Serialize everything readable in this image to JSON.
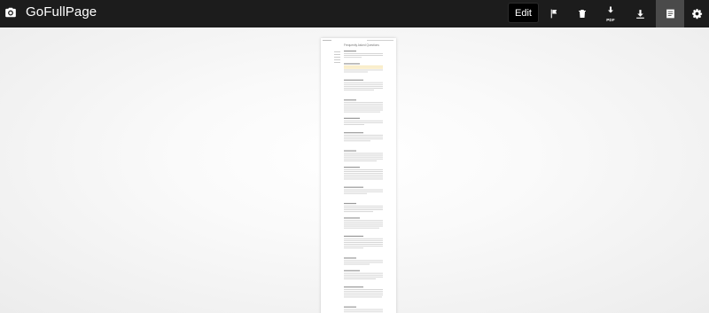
{
  "app": {
    "title": "GoFullPage",
    "icon": "camera-icon"
  },
  "toolbar": {
    "edit_label": "Edit",
    "pdf_badge": "PDF",
    "tools": [
      {
        "name": "flag-icon"
      },
      {
        "name": "trash-icon"
      },
      {
        "name": "download-pdf-icon"
      },
      {
        "name": "download-icon"
      },
      {
        "name": "document-icon",
        "active": true
      },
      {
        "name": "gear-icon"
      }
    ]
  },
  "preview": {
    "page_heading": "Frequently Asked Questions"
  },
  "colors": {
    "topbar": "#1c1c1c",
    "active_tool": "#4a4a4a",
    "stage": "#ececec",
    "highlight": "#f3d98b"
  }
}
